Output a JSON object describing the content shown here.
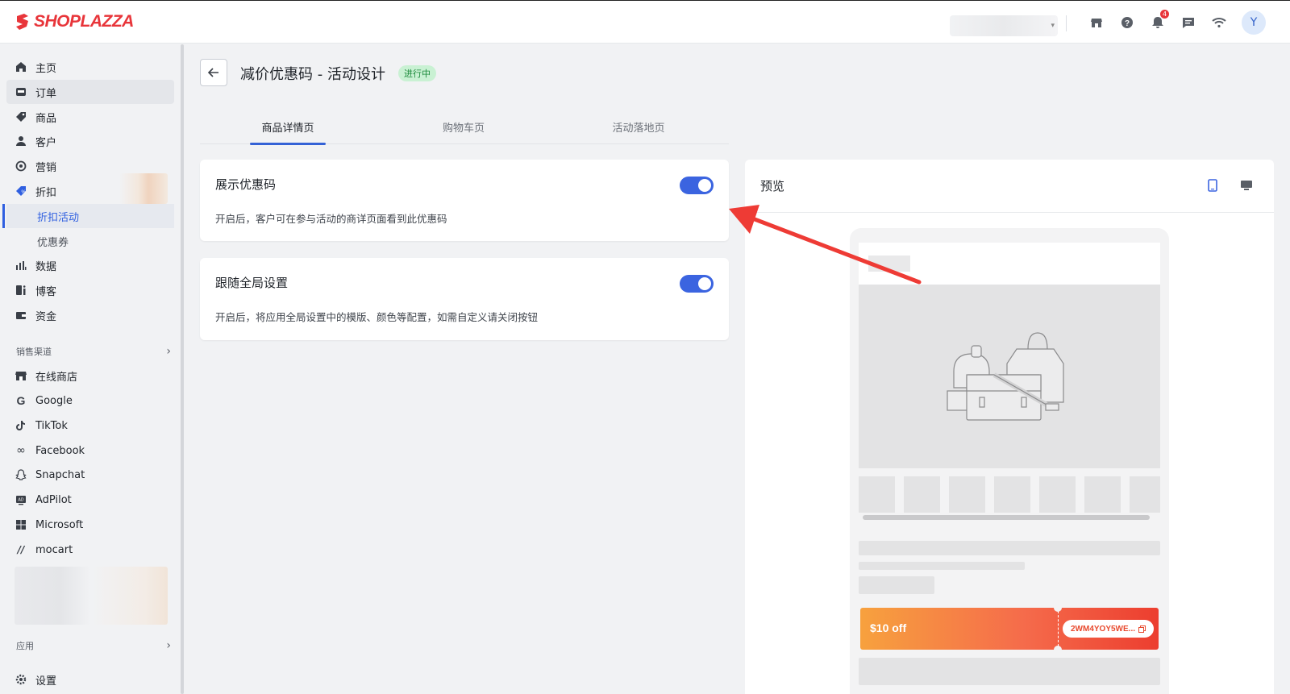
{
  "topbar": {
    "logo_text": "SHOPLAZZA",
    "notification_count": "4",
    "avatar_initial": "Y",
    "icons": [
      "store-icon",
      "help-icon",
      "bell-icon",
      "message-icon",
      "wifi-icon"
    ]
  },
  "sidebar": {
    "items": [
      {
        "label": "主页",
        "icon": "home-icon"
      },
      {
        "label": "订单",
        "icon": "order-icon"
      },
      {
        "label": "商品",
        "icon": "tag-icon"
      },
      {
        "label": "客户",
        "icon": "user-icon"
      },
      {
        "label": "营销",
        "icon": "marketing-icon"
      },
      {
        "label": "折扣",
        "icon": "discount-icon"
      }
    ],
    "discount_sub": [
      {
        "label": "折扣活动"
      },
      {
        "label": "优惠券"
      }
    ],
    "items2": [
      {
        "label": "数据",
        "icon": "chart-icon"
      },
      {
        "label": "博客",
        "icon": "blog-icon"
      },
      {
        "label": "资金",
        "icon": "wallet-icon"
      }
    ],
    "sales_channels_label": "销售渠道",
    "channels": [
      {
        "label": "在线商店",
        "icon": "store-icon"
      },
      {
        "label": "Google",
        "icon": "google-icon"
      },
      {
        "label": "TikTok",
        "icon": "tiktok-icon"
      },
      {
        "label": "Facebook",
        "icon": "meta-icon"
      },
      {
        "label": "Snapchat",
        "icon": "snapchat-icon"
      },
      {
        "label": "AdPilot",
        "icon": "adpilot-icon"
      },
      {
        "label": "Microsoft",
        "icon": "microsoft-icon"
      },
      {
        "label": "mocart",
        "icon": "mocart-icon"
      }
    ],
    "apps_label": "应用",
    "settings_label": "设置"
  },
  "header": {
    "title": "减价优惠码 - 活动设计",
    "status": "进行中"
  },
  "tabs": [
    {
      "label": "商品详情页"
    },
    {
      "label": "购物车页"
    },
    {
      "label": "活动落地页"
    }
  ],
  "settings": [
    {
      "title": "展示优惠码",
      "description": "开启后，客户可在参与活动的商详页面看到此优惠码",
      "enabled": true
    },
    {
      "title": "跟随全局设置",
      "description": "开启后，将应用全局设置中的模版、颜色等配置，如需自定义请关闭按钮",
      "enabled": true
    }
  ],
  "preview": {
    "title": "预览",
    "coupon_amount": "$10 off",
    "coupon_code": "2WM4YOY5WE...",
    "accent": "#3b64e0"
  }
}
